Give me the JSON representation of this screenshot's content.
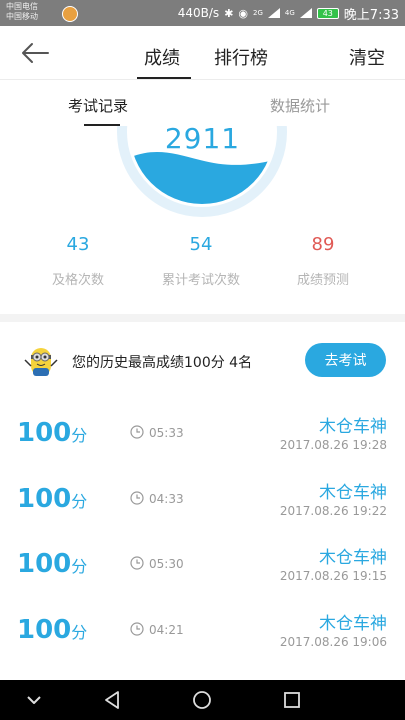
{
  "status_bar": {
    "carrier_1": "中国电信",
    "carrier_2": "中国移动",
    "speed": "440B/s",
    "signal_1": "2G",
    "signal_2": "4G",
    "battery": "43",
    "time": "晚上7:33"
  },
  "header": {
    "tab_score": "成绩",
    "tab_rank": "排行榜",
    "clear": "清空"
  },
  "subtabs": {
    "records": "考试记录",
    "stats": "数据统计"
  },
  "gauge": {
    "value": "2911",
    "color": "#2aa8e0"
  },
  "stats": [
    {
      "value": "43",
      "label": "及格次数",
      "color": "#2aa8e0"
    },
    {
      "value": "54",
      "label": "累计考试次数",
      "color": "#2aa8e0"
    },
    {
      "value": "89",
      "label": "成绩预测",
      "color": "#e05a55"
    }
  ],
  "best": {
    "text": "您的历史最高成绩100分  4名",
    "button": "去考试"
  },
  "records": [
    {
      "score": "100",
      "unit": "分",
      "duration": "05:33",
      "name": "木仓车神",
      "date": "2017.08.26   19:28"
    },
    {
      "score": "100",
      "unit": "分",
      "duration": "04:33",
      "name": "木仓车神",
      "date": "2017.08.26   19:22"
    },
    {
      "score": "100",
      "unit": "分",
      "duration": "05:30",
      "name": "木仓车神",
      "date": "2017.08.26   19:15"
    },
    {
      "score": "100",
      "unit": "分",
      "duration": "04:21",
      "name": "木仓车神",
      "date": "2017.08.26   19:06"
    }
  ]
}
